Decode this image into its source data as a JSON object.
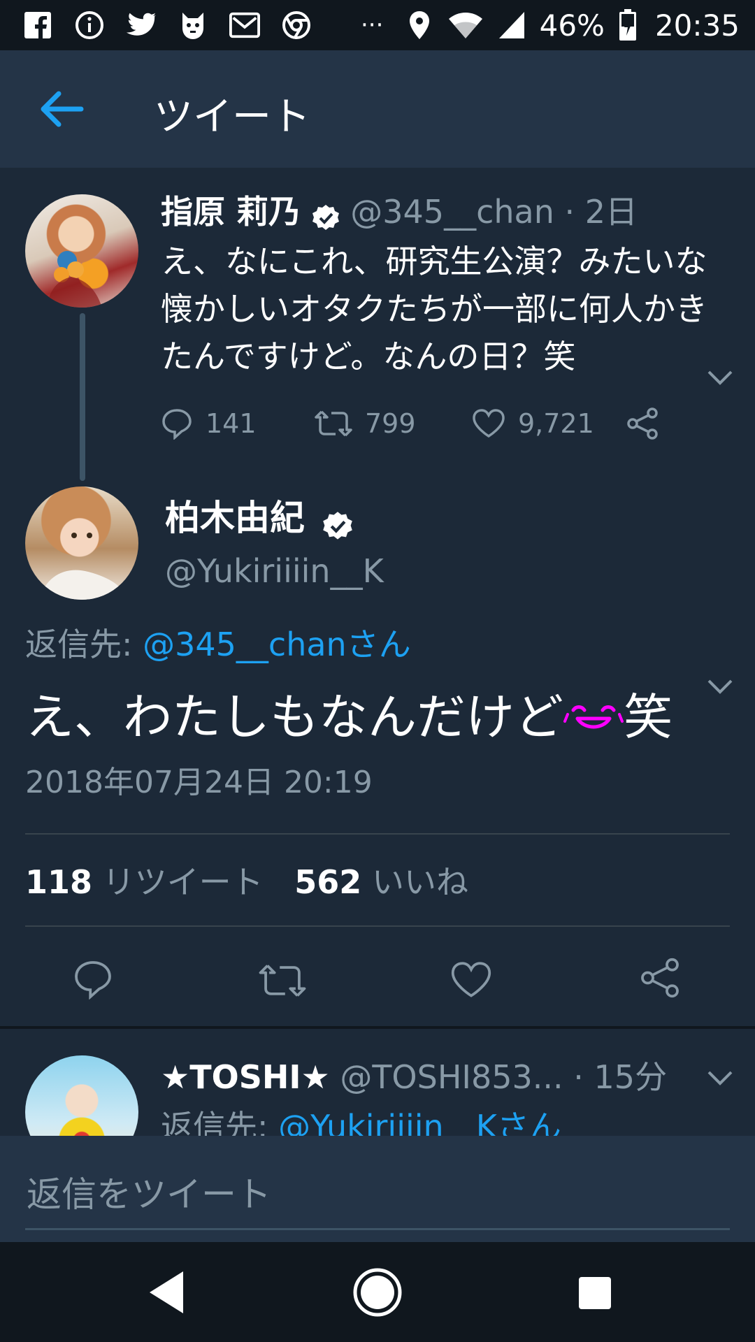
{
  "status_bar": {
    "icons": [
      "facebook-icon",
      "info-icon",
      "twitter-icon",
      "app-icon",
      "mail-icon",
      "chrome-icon",
      "more-icon",
      "location-icon",
      "wifi-icon",
      "signal-icon",
      "battery-icon"
    ],
    "battery": "46%",
    "time": "20:35",
    "more": "···"
  },
  "app_bar": {
    "title": "ツイート"
  },
  "parent_tweet": {
    "display_name": "指原 莉乃",
    "handle": "@345__chan",
    "time_sep": "·",
    "time": "2日",
    "text": "え、なにこれ、研究生公演？みたいな懐かしいオタクたちが一部に何人かきたんですけど。なんの日？笑",
    "replies": "141",
    "retweets": "799",
    "likes": "9,721"
  },
  "main_tweet": {
    "display_name": "柏木由紀",
    "handle": "@Yukiriiiin__K",
    "reply_to_label": "返信先:",
    "reply_to_user": "@345__chanさん",
    "text_before": "え、わたしもなんだけど",
    "text_after": "笑",
    "timestamp": "2018年07月24日 20:19",
    "retweet_count": "118",
    "retweet_label": "リツイート",
    "like_count": "562",
    "like_label": "いいね"
  },
  "next_reply": {
    "display_name": "★TOSHI★",
    "handle": "@TOSHI853...",
    "time_sep": "·",
    "time": "15分",
    "reply_to_label": "返信先:",
    "reply_to_user": "@Yukiriiiin__Kさん"
  },
  "reply_bar": {
    "placeholder": "返信をツイート"
  },
  "colors": {
    "background": "#1c2938",
    "header": "#243447",
    "accent": "#1da1f2",
    "muted": "#8899a6",
    "emoji": "#ff00ff"
  }
}
